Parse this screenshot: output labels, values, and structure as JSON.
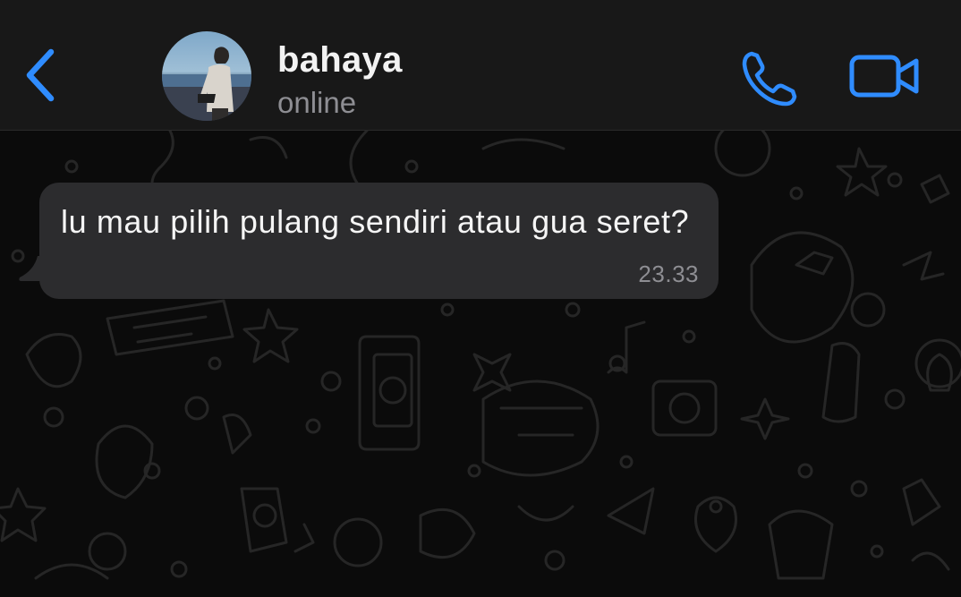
{
  "header": {
    "back_icon": "chevron-left-icon",
    "contact_name": "bahaya",
    "status": "online",
    "call_icon": "phone-icon",
    "video_icon": "video-camera-icon"
  },
  "messages": [
    {
      "direction": "incoming",
      "text": "lu mau pilih pulang sendiri atau gua seret?",
      "time": "23.33"
    }
  ],
  "colors": {
    "accent": "#2f8cff",
    "header_bg": "#181818",
    "chat_bg": "#0b0b0b",
    "bubble_bg": "#2c2c2e",
    "text": "#f5f5f5",
    "secondary_text": "#8e8e93"
  }
}
